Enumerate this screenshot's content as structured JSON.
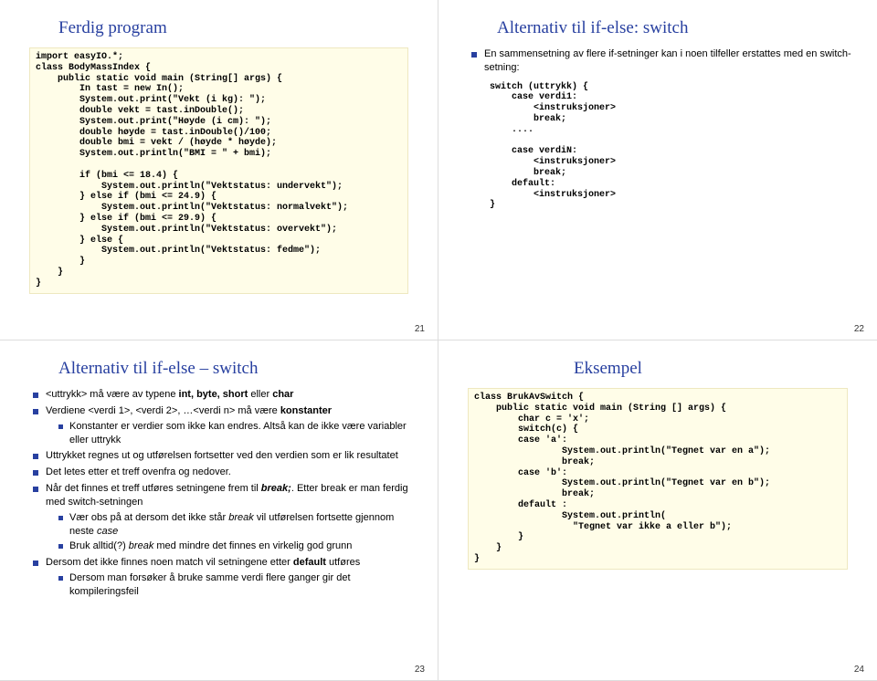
{
  "slides": {
    "s21": {
      "title": "Ferdig program",
      "code": "import easyIO.*;\nclass BodyMassIndex {\n    public static void main (String[] args) {\n        In tast = new In();\n        System.out.print(\"Vekt (i kg): \");\n        double vekt = tast.inDouble();\n        System.out.print(\"Høyde (i cm): \");\n        double høyde = tast.inDouble()/100;\n        double bmi = vekt / (høyde * høyde);\n        System.out.println(\"BMI = \" + bmi);\n\n        if (bmi <= 18.4) {\n            System.out.println(\"Vektstatus: undervekt\");\n        } else if (bmi <= 24.9) {\n            System.out.println(\"Vektstatus: normalvekt\");\n        } else if (bmi <= 29.9) {\n            System.out.println(\"Vektstatus: overvekt\");\n        } else {\n            System.out.println(\"Vektstatus: fedme\");\n        }\n    }\n}",
      "page": "21"
    },
    "s22": {
      "title": "Alternativ til if-else: switch",
      "intro": "En sammensetning av flere if-setninger kan i noen tilfeller erstattes med en switch-setning:",
      "code": "switch (uttrykk) {\n    case verdi1:\n        <instruksjoner>\n        break;\n    ....\n\n    case verdiN:\n        <instruksjoner>\n        break;\n    default:\n        <instruksjoner>\n}",
      "page": "22"
    },
    "s23": {
      "title": "Alternativ til if-else – switch",
      "b1_a": "<uttrykk> må være av typene ",
      "b1_b": "int, byte, short",
      "b1_c": " eller ",
      "b1_d": "char",
      "b2_a": "Verdiene <verdi 1>, <verdi 2>, …<verdi n> må være ",
      "b2_b": "konstanter",
      "b2_sub": "Konstanter er verdier som ikke kan endres. Altså kan de ikke være variabler eller uttrykk",
      "b3": "Uttrykket regnes ut og utførelsen fortsetter ved den verdien som er lik resultatet",
      "b4": "Det letes etter et treff ovenfra og nedover.",
      "b5_a": "Når det finnes et treff utføres setningene frem til ",
      "b5_b": "break;",
      "b5_c": ". Etter break er man ferdig med switch-setningen",
      "b5_sub1_a": "Vær obs på at dersom det ikke står ",
      "b5_sub1_b": "break",
      "b5_sub1_c": " vil utførelsen fortsette gjennom neste ",
      "b5_sub1_d": "case",
      "b5_sub2_a": "Bruk alltid(?) ",
      "b5_sub2_b": "break",
      "b5_sub2_c": " med mindre det finnes en virkelig god grunn",
      "b6_a": "Dersom det ikke finnes noen match vil setningene etter ",
      "b6_b": "default",
      "b6_c": " utføres",
      "b6_sub": "Dersom man forsøker å bruke samme verdi flere ganger gir det kompileringsfeil",
      "page": "23"
    },
    "s24": {
      "title": "Eksempel",
      "code": "class BrukAvSwitch {\n    public static void main (String [] args) {\n        char c = 'x';\n        switch(c) {\n        case 'a':\n                System.out.println(\"Tegnet var en a\");\n                break;\n        case 'b':\n                System.out.println(\"Tegnet var en b\");\n                break;\n        default :\n                System.out.println(\n                  \"Tegnet var ikke a eller b\");\n        }\n    }\n}",
      "page": "24"
    }
  }
}
